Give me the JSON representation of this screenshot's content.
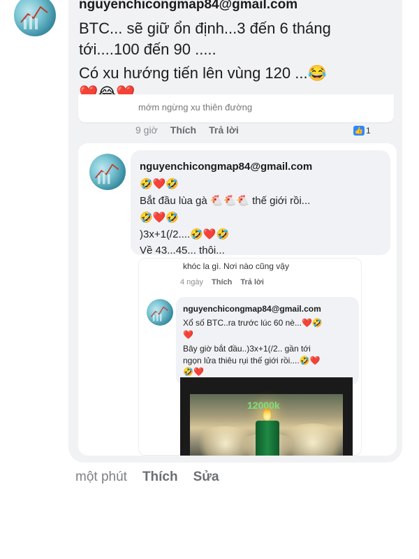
{
  "top_comment": {
    "author": "nguyenchicongmap84@gmail.com",
    "line1": "BTC... sẽ giữ ổn định...3 đến 6 tháng",
    "line2": "tới....100 đến 90 .....",
    "line3": "Có xu hướng tiến lên vùng 120 ...😂",
    "line4": "❤️😂❤️"
  },
  "screenshot_top": {
    "cut_text": "mớm ngừng xu thiên đường",
    "time": "9 giờ",
    "like": "Thích",
    "reply": "Trả lời",
    "like_count": "1"
  },
  "reply": {
    "author": "nguyenchicongmap84@gmail.com",
    "line1": "🤣❤️🤣",
    "line2": "Bắt đầu lùa gà 🐔🐔🐔 thế giới rồi...",
    "line3": "🤣❤️🤣",
    "line4": ")3x+1(/2....🤣❤️🤣",
    "line5": "Về 43...45... thôi...",
    "sub_text": "khóc la gì. Nơi nào cũng vậy",
    "time": "4 ngày",
    "like": "Thích",
    "reply_action": "Trả lời"
  },
  "nested": {
    "author": "nguyenchicongmap84@gmail.com",
    "line1": "Xổ số BTC..ra trước lúc 60 nè...❤️🤣",
    "line2": "❤️",
    "line3": "Bây giờ bắt đầu..)3x+1(/2.. gần tới",
    "line4": "ngọn lửa thiêu rụi thế giới rồi....🤣❤️",
    "line5": "🤣❤️",
    "image_label": "12000k"
  },
  "footer": {
    "time": "một phút",
    "like": "Thích",
    "edit": "Sửa"
  }
}
